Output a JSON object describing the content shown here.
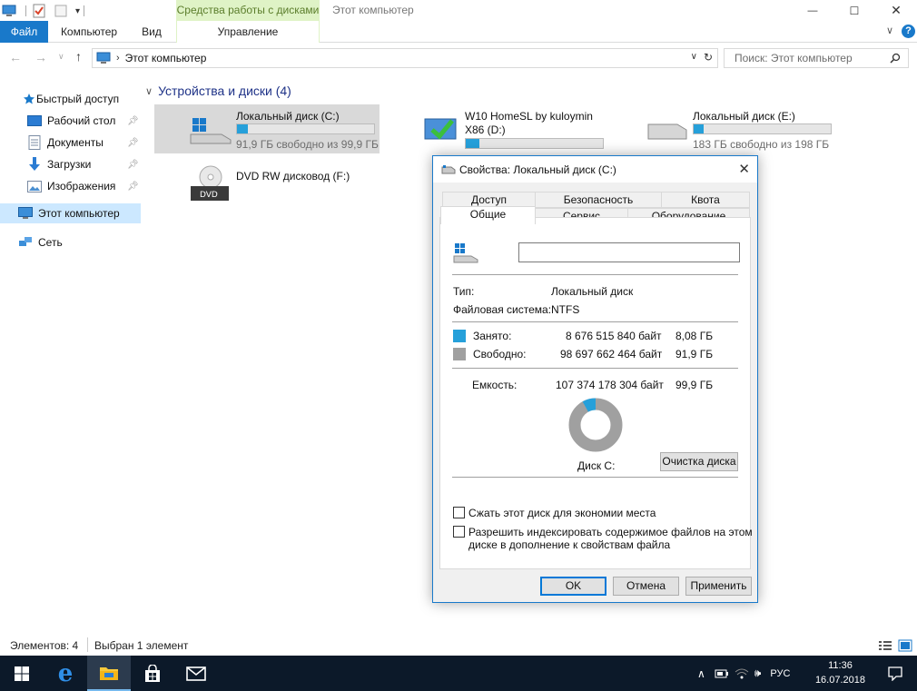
{
  "window": {
    "context_tab_header": "Средства работы с дисками",
    "title": "Этот компьютер",
    "minimize_glyph": "—",
    "maximize_glyph": "☐",
    "close_glyph": "✕"
  },
  "ribbon": {
    "tabs": [
      "Файл",
      "Компьютер",
      "Вид",
      "Управление"
    ],
    "help_glyph": "?"
  },
  "address": {
    "path": "Этот компьютер",
    "search_placeholder": "Поиск: Этот компьютер"
  },
  "nav": {
    "items": [
      {
        "label": "Быстрый доступ",
        "icon": "star-icon",
        "pinned": false
      },
      {
        "label": "Рабочий стол",
        "icon": "desktop-icon",
        "pinned": true
      },
      {
        "label": "Документы",
        "icon": "documents-icon",
        "pinned": true
      },
      {
        "label": "Загрузки",
        "icon": "downloads-icon",
        "pinned": true
      },
      {
        "label": "Изображения",
        "icon": "pictures-icon",
        "pinned": true
      },
      {
        "label": "Этот компьютер",
        "icon": "computer-icon",
        "selected": true
      },
      {
        "label": "Сеть",
        "icon": "network-icon"
      }
    ]
  },
  "content": {
    "group_title": "Устройства и диски (4)",
    "drives": [
      {
        "name": "Локальный диск (C:)",
        "free_text": "91,9 ГБ свободно из 99,9 ГБ",
        "used_fraction": 0.081,
        "selected": true
      },
      {
        "name": "W10 HomeSL by kuloymin",
        "name2": "X86 (D:)",
        "used_fraction": 0.1
      },
      {
        "name": "Локальный диск (E:)",
        "free_text": "183 ГБ свободно из 198 ГБ",
        "used_fraction": 0.076
      },
      {
        "name": "DVD RW дисковод (F:)",
        "badge": "DVD"
      }
    ]
  },
  "status": {
    "items_count": "Элементов: 4",
    "selected": "Выбран 1 элемент"
  },
  "taskbar": {
    "tray_lang": "РУС",
    "time": "11:36",
    "date": "16.07.2018"
  },
  "dialog": {
    "title": "Свойства: Локальный диск (C:)",
    "tabs_row1": [
      "Доступ",
      "Безопасность",
      "Квота"
    ],
    "tabs_row2": [
      "Общие",
      "Сервис",
      "Оборудование"
    ],
    "volume_name": "",
    "type_label": "Тип:",
    "type_value": "Локальный диск",
    "fs_label": "Файловая система:",
    "fs_value": "NTFS",
    "used_label": "Занято:",
    "used_bytes": "8 676 515 840 байт",
    "used_gb": "8,08 ГБ",
    "free_label": "Свободно:",
    "free_bytes": "98 697 662 464 байт",
    "free_gb": "91,9 ГБ",
    "capacity_label": "Емкость:",
    "capacity_bytes": "107 374 178 304 байт",
    "capacity_gb": "99,9 ГБ",
    "used_fraction": 0.0808,
    "disk_label": "Диск C:",
    "cleanup_button": "Очистка диска",
    "compress_label": "Сжать этот диск для экономии места",
    "index_label_line1": "Разрешить индексировать содержимое файлов на этом",
    "index_label_line2": "диске в дополнение к свойствам файла",
    "ok": "OK",
    "cancel": "Отмена",
    "apply": "Применить",
    "colors": {
      "used": "#26a0da",
      "free": "#a0a0a0"
    }
  }
}
